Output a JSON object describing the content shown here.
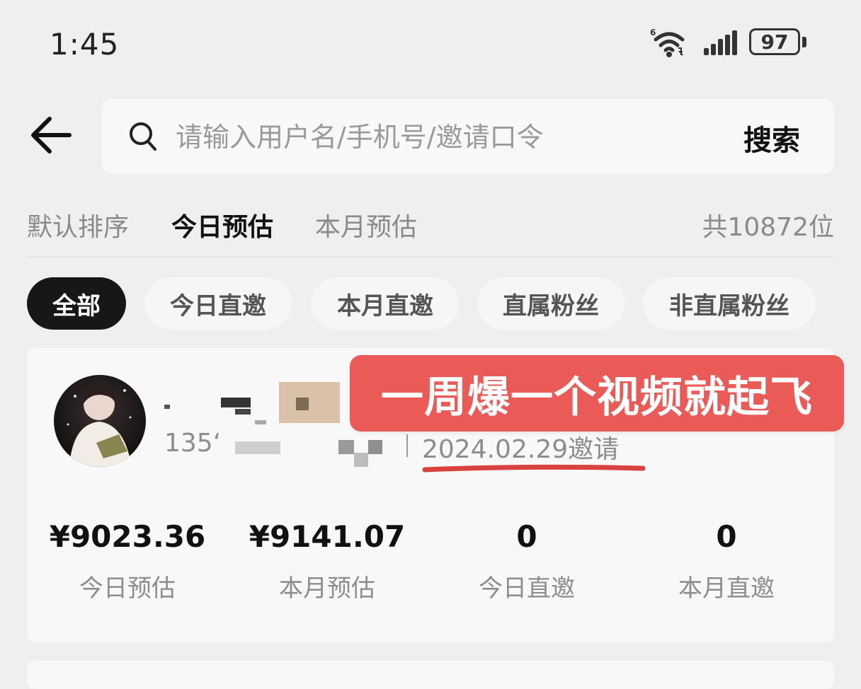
{
  "status_bar": {
    "time": "1:45",
    "wifi_badge": "6",
    "battery": "97"
  },
  "top_bar": {
    "back_icon": "arrow-left-icon",
    "search_icon": "search-icon",
    "search_placeholder": "请输入用户名/手机号/邀请口令",
    "search_value": "",
    "search_button": "搜索"
  },
  "sort_tabs": [
    {
      "label": "默认排序",
      "active": false
    },
    {
      "label": "今日预估",
      "active": true
    },
    {
      "label": "本月预估",
      "active": false
    }
  ],
  "total": "共10872位",
  "filter_chips": [
    {
      "label": "全部",
      "active": true
    },
    {
      "label": "今日直邀",
      "active": false
    },
    {
      "label": "本月直邀",
      "active": false
    },
    {
      "label": "直属粉丝",
      "active": false
    },
    {
      "label": "非直属粉丝",
      "active": false
    }
  ],
  "user_card": {
    "phone": "135ʻ",
    "invite_date": "2024.02.29邀请",
    "promo_overlay": "一周爆一个视频就起飞",
    "stats": [
      {
        "value": "¥9023.36",
        "label": "今日预估"
      },
      {
        "value": "¥9141.07",
        "label": "本月预估"
      },
      {
        "value": "0",
        "label": "今日直邀"
      },
      {
        "value": "0",
        "label": "本月直邀"
      }
    ]
  },
  "colors": {
    "background": "#efefef",
    "card": "#f8f8f8",
    "active_chip": "#171717",
    "promo": "#ea5a57",
    "underline": "#d9423f"
  }
}
